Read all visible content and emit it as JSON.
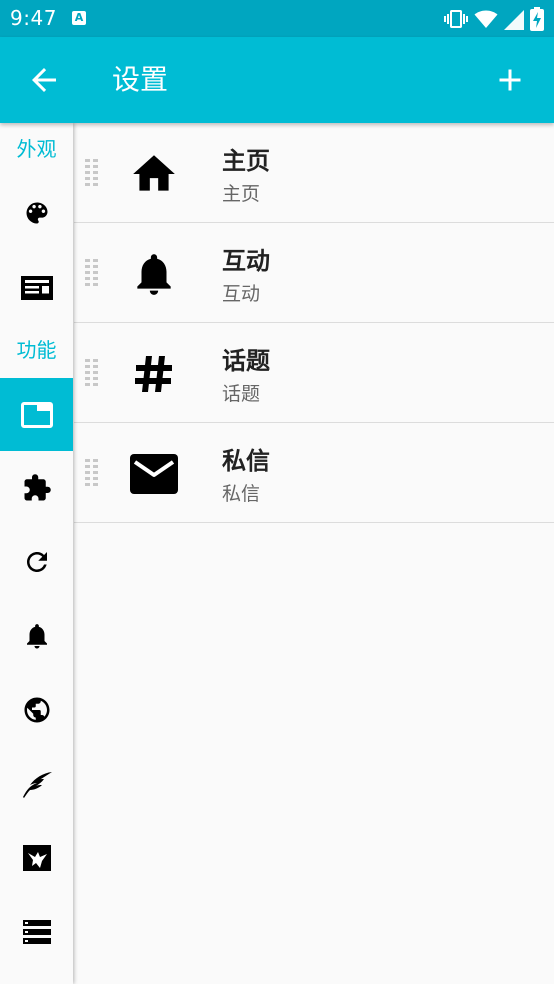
{
  "status_bar": {
    "time": "9:47",
    "notification_icon": "a-badge-icon",
    "right_icons": [
      "vibrate-icon",
      "wifi-icon",
      "signal-icon",
      "battery-charging-icon"
    ]
  },
  "app_bar": {
    "title": "设置",
    "back_icon": "arrow-left-icon",
    "add_icon": "plus-icon"
  },
  "sidebar": {
    "sections": [
      {
        "label": "外观"
      },
      {
        "label": "功能"
      }
    ],
    "items": [
      {
        "icon": "palette-icon",
        "active": false
      },
      {
        "icon": "newspaper-icon",
        "active": false
      },
      {
        "icon": "tab-folder-icon",
        "active": true
      },
      {
        "icon": "puzzle-icon",
        "active": false
      },
      {
        "icon": "refresh-icon",
        "active": false
      },
      {
        "icon": "bell-icon",
        "active": false
      },
      {
        "icon": "globe-icon",
        "active": false
      },
      {
        "icon": "feather-icon",
        "active": false
      },
      {
        "icon": "image-bird-icon",
        "active": false
      },
      {
        "icon": "storage-icon",
        "active": false
      }
    ]
  },
  "tabs_list": [
    {
      "title": "主页",
      "subtitle": "主页",
      "icon": "home-icon"
    },
    {
      "title": "互动",
      "subtitle": "互动",
      "icon": "bell-icon"
    },
    {
      "title": "话题",
      "subtitle": "话题",
      "icon": "hashtag-icon"
    },
    {
      "title": "私信",
      "subtitle": "私信",
      "icon": "mail-icon"
    }
  ],
  "colors": {
    "status_bar": "#00a6c0",
    "app_bar": "#00bcd4",
    "accent": "#00bcd4",
    "background": "#fafafa",
    "divider": "#dcdcdc"
  }
}
